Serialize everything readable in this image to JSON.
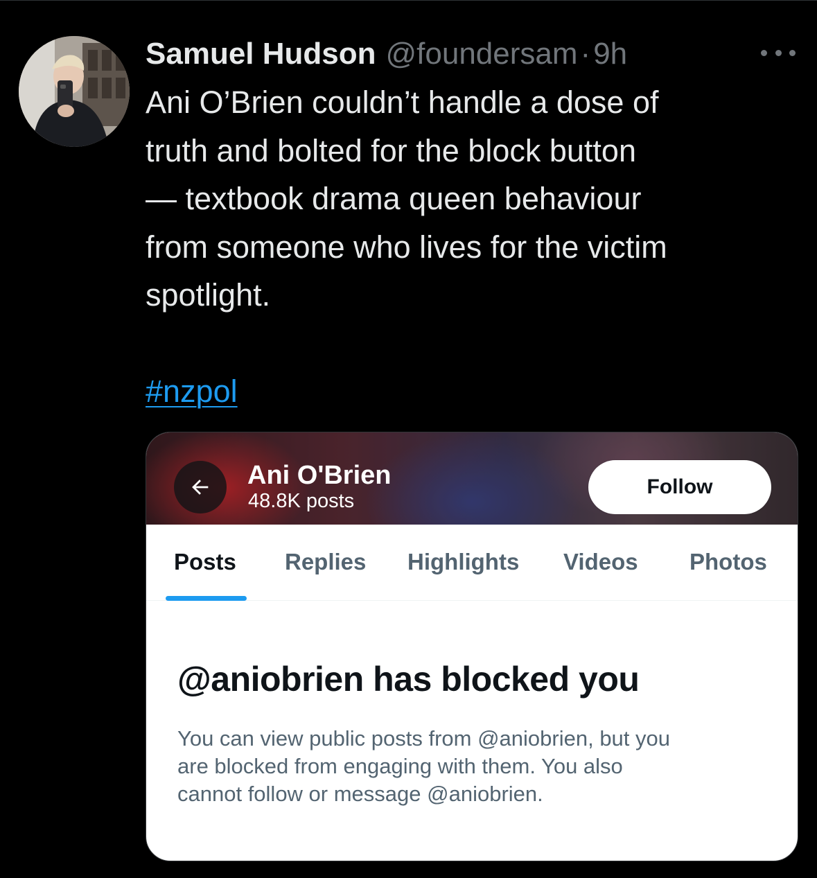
{
  "tweet": {
    "author": {
      "display_name": "Samuel Hudson",
      "handle": "@foundersam",
      "separator": "·",
      "timestamp": "9h"
    },
    "text": "Ani O’Brien couldn’t handle a dose of\ntruth and bolted for the block button\n— textbook drama queen behaviour\nfrom someone who lives for the victim\nspotlight.",
    "hashtag": "#nzpol",
    "more_icon": "more-horizontal-icon"
  },
  "embedded_screenshot": {
    "profile_name": "Ani O'Brien",
    "post_count": "48.8K posts",
    "back_icon": "arrow-left-icon",
    "follow_label": "Follow",
    "tabs": [
      {
        "label": "Posts",
        "active": true
      },
      {
        "label": "Replies",
        "active": false
      },
      {
        "label": "Highlights",
        "active": false
      },
      {
        "label": "Videos",
        "active": false
      },
      {
        "label": "Photos",
        "active": false
      }
    ],
    "blocked_title": "@aniobrien has blocked you",
    "blocked_description": "You can view public posts from @aniobrien, but you\nare blocked from engaging with them. You also\ncannot follow or message @aniobrien."
  },
  "colors": {
    "background": "#000000",
    "text_primary": "#e7e9ea",
    "text_secondary": "#71767b",
    "link": "#1d9bf0",
    "card_background": "#ffffff",
    "card_text": "#0f1419",
    "card_muted": "#536471"
  }
}
